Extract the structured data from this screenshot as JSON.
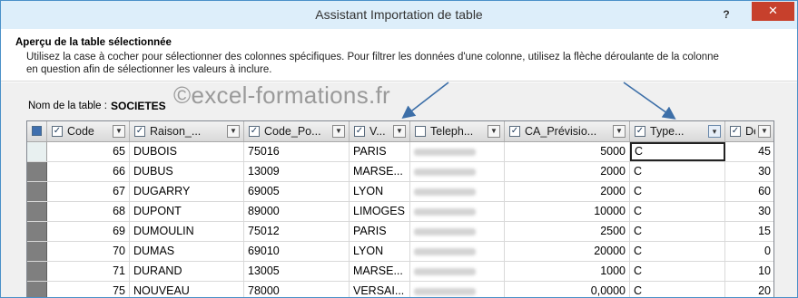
{
  "window": {
    "title": "Assistant Importation de table",
    "help_glyph": "?",
    "close_glyph": "✕"
  },
  "description": {
    "heading": "Aperçu de la table sélectionnée",
    "line1": "Utilisez la case à cocher pour sélectionner des colonnes spécifiques. Pour filtrer les données d'une colonne, utilisez la flèche déroulante de la colonne",
    "line2": "en question afin de sélectionner les valeurs à inclure."
  },
  "table_name": {
    "label": "Nom de la table :",
    "value": "SOCIETES"
  },
  "watermark": "©excel-formations.fr",
  "columns": [
    {
      "label": "Code",
      "checked": true
    },
    {
      "label": "Raison_...",
      "checked": true
    },
    {
      "label": "Code_Po...",
      "checked": true
    },
    {
      "label": "V...",
      "checked": true
    },
    {
      "label": "Teleph...",
      "checked": false
    },
    {
      "label": "CA_Prévisio...",
      "checked": true
    },
    {
      "label": "Type...",
      "checked": true,
      "filtered": true
    },
    {
      "label": "Dela...",
      "checked": true
    }
  ],
  "rows": [
    [
      "65",
      "DUBOIS",
      "75016",
      "PARIS",
      "",
      "5000",
      "C",
      "45"
    ],
    [
      "66",
      "DUBUS",
      "13009",
      "MARSE...",
      "",
      "2000",
      "C",
      "30"
    ],
    [
      "67",
      "DUGARRY",
      "69005",
      "LYON",
      "",
      "2000",
      "C",
      "60"
    ],
    [
      "68",
      "DUPONT",
      "89000",
      "LIMOGES",
      "",
      "10000",
      "C",
      "30"
    ],
    [
      "69",
      "DUMOULIN",
      "75012",
      "PARIS",
      "",
      "2500",
      "C",
      "15"
    ],
    [
      "70",
      "DUMAS",
      "69010",
      "LYON",
      "",
      "20000",
      "C",
      "0"
    ],
    [
      "71",
      "DURAND",
      "13005",
      "MARSE...",
      "",
      "1000",
      "C",
      "10"
    ],
    [
      "75",
      "NOUVEAU",
      "78000",
      "VERSAI...",
      "",
      "0,0000",
      "C",
      "20"
    ]
  ],
  "icons": {
    "checkbox": "checkbox-checked-icon",
    "dropdown": "chevron-down-icon",
    "filter": "filter-icon"
  },
  "colors": {
    "title_bg": "#ddeefa",
    "close_bg": "#c7402c",
    "arrow": "#3d6fa8",
    "row_header": "#7f7f7f"
  }
}
